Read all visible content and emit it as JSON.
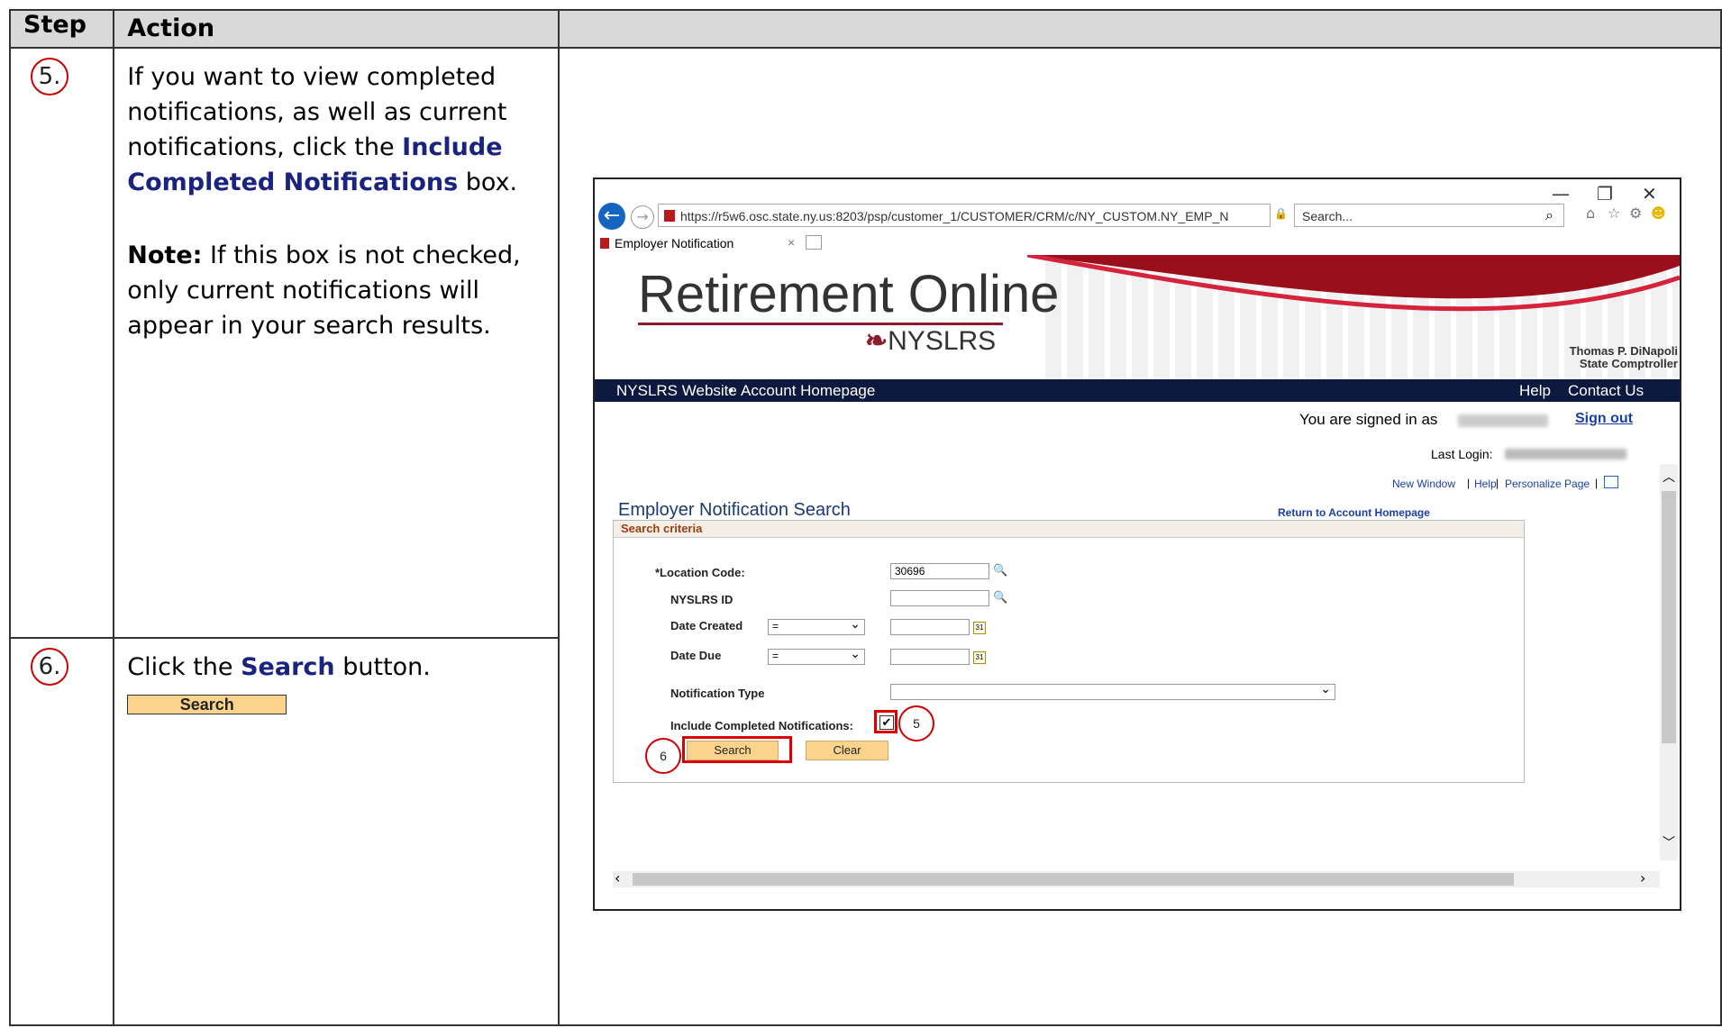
{
  "table": {
    "header_step": "Step",
    "header_action": "Action",
    "rows": [
      {
        "step": "5.",
        "text_a": "If you want to view completed notifications, as well as current notifications, click the ",
        "kw_a": "Include Completed Notifications",
        "text_b": " box.",
        "note_label": "Note:",
        "note_text": " If this box is not checked, only current notifications will appear in your search results."
      },
      {
        "step": "6.",
        "text_a": "Click the ",
        "kw_a": "Search",
        "text_b": " button.",
        "button_label": "Search"
      }
    ]
  },
  "browser": {
    "url": "https://r5w6.osc.state.ny.us:8203/psp/customer_1/CUSTOMER/CRM/c/NY_CUSTOM.NY_EMP_N",
    "search_placeholder": "Search...",
    "tab_title": "Employer Notification"
  },
  "banner": {
    "title": "Retirement Online",
    "org": "NYSLRS",
    "comptroller_name": "Thomas P. DiNapoli",
    "comptroller_title": "State Comptroller"
  },
  "nav": {
    "left_1": "NYSLRS Website",
    "left_2": "Account Homepage",
    "right_1": "Help",
    "right_2": "Contact Us"
  },
  "user": {
    "signed_in": "You are signed in as",
    "sign_out": "Sign out",
    "last_login": "Last Login:"
  },
  "page_links": {
    "new_window": "New Window",
    "help": "Help",
    "personalize": "Personalize Page"
  },
  "form": {
    "title": "Employer Notification Search",
    "return_link": "Return to Account Homepage",
    "section": "Search criteria",
    "location_label": "*Location Code:",
    "location_value": "30696",
    "nyslrs_label": "NYSLRS ID",
    "date_created_label": "Date Created",
    "date_created_op": "=",
    "date_due_label": "Date Due",
    "date_due_op": "=",
    "notif_type_label": "Notification Type",
    "include_label": "Include Completed Notifications:",
    "search_btn": "Search",
    "clear_btn": "Clear"
  },
  "callouts": {
    "c5": "5",
    "c6": "6"
  }
}
